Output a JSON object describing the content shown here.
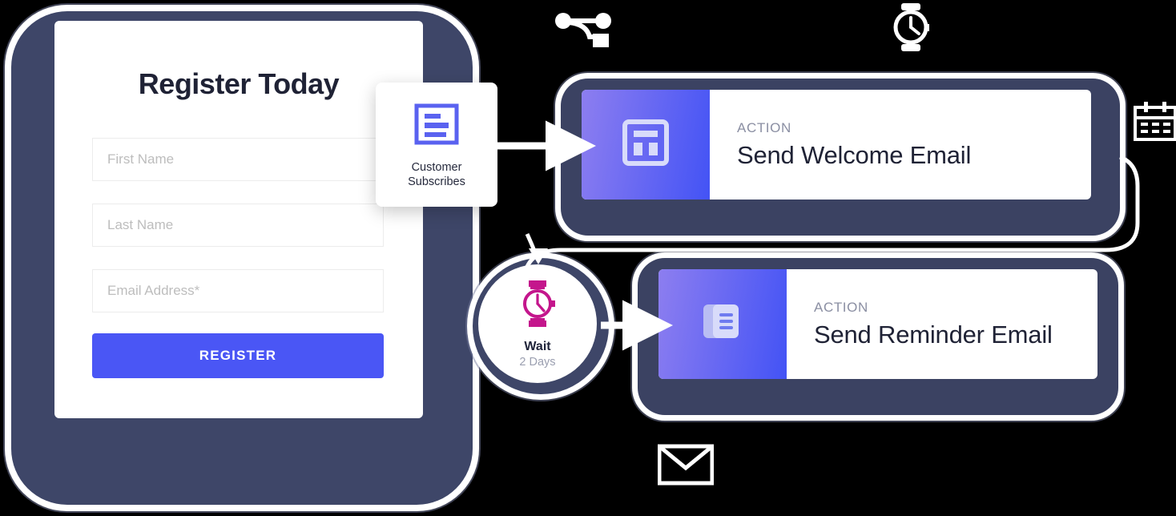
{
  "registration_panel": {
    "title": "Register Today",
    "fields": [
      {
        "name": "first-name",
        "placeholder": "First Name",
        "value": ""
      },
      {
        "name": "last-name",
        "placeholder": "Last Name",
        "value": ""
      },
      {
        "name": "email-address",
        "placeholder": "Email Address*",
        "value": ""
      }
    ],
    "submit_label": "REGISTER",
    "accent_color": "#4a56f5",
    "plate_color": "#3e4668",
    "title_color": "#1f2235",
    "placeholder_color": "#bdbdbd"
  },
  "trigger": {
    "icon": "form-icon",
    "icon_color": "#5a62f0",
    "label_line1": "Customer",
    "label_line2": "Subscribes"
  },
  "wait_node": {
    "icon": "watch-icon",
    "icon_color": "#c4168c",
    "label": "Wait",
    "duration": "2 Days",
    "plate_color": "#3e4668"
  },
  "actions": [
    {
      "kicker": "ACTION",
      "title": "Send Welcome Email",
      "icon": "layout-template-icon",
      "gradient_from": "#8d7ef0",
      "gradient_to": "#4353f5"
    },
    {
      "kicker": "ACTION",
      "title": "Send Reminder Email",
      "icon": "documents-stack-icon",
      "gradient_from": "#8d7ef0",
      "gradient_to": "#4353f5"
    }
  ],
  "decorative_icons": [
    {
      "name": "branch-node-icon",
      "color": "#ffffff"
    },
    {
      "name": "watch-icon",
      "color": "#ffffff"
    },
    {
      "name": "calendar-icon",
      "color": "#ffffff"
    },
    {
      "name": "envelope-icon",
      "color": "#ffffff"
    }
  ],
  "colors": {
    "background": "#000000",
    "card_surface": "#ffffff",
    "plate_navy": "#3b4262",
    "connector": "#ffffff"
  }
}
